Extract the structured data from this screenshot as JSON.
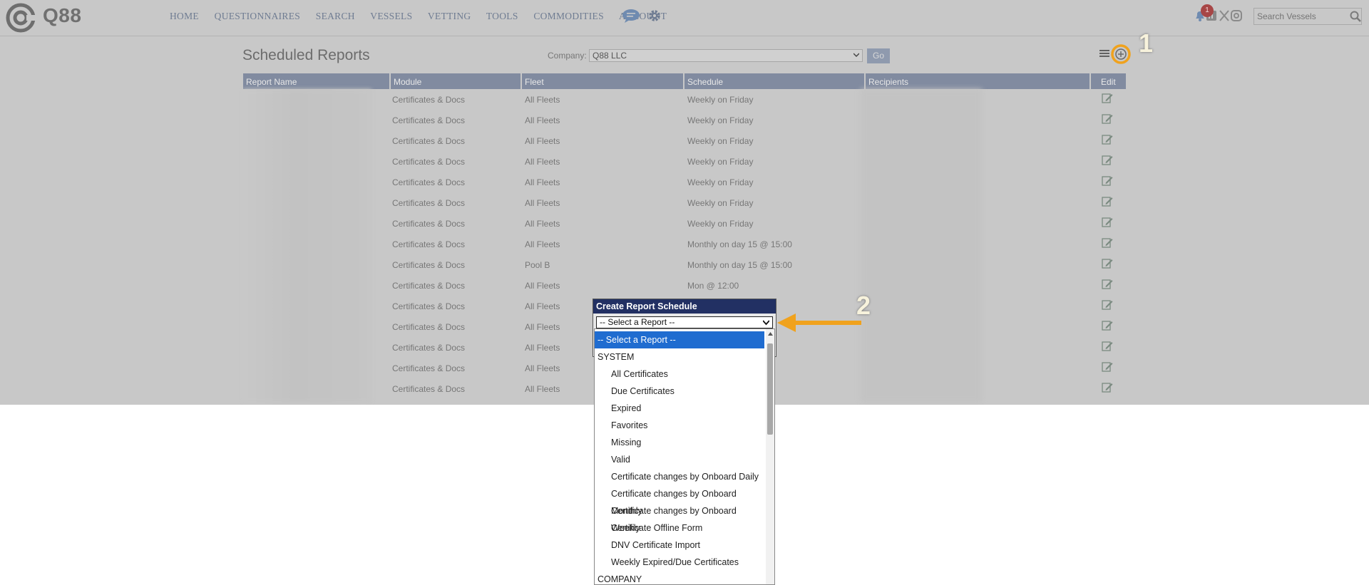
{
  "brand": {
    "name": "Q88"
  },
  "nav": {
    "items": [
      "HOME",
      "QUESTIONNAIRES",
      "SEARCH",
      "VESSELS",
      "VETTING",
      "TOOLS",
      "COMMODITIES",
      "ACCOUNT"
    ]
  },
  "notifications": {
    "count": "1"
  },
  "search": {
    "placeholder": "Search Vessels"
  },
  "page": {
    "title": "Scheduled Reports"
  },
  "company": {
    "label": "Company:",
    "selected": "Q88 LLC",
    "go_label": "Go"
  },
  "annotations": {
    "step1": "1",
    "step2": "2"
  },
  "table": {
    "headers": [
      "Report Name",
      "Module",
      "Fleet",
      "Schedule",
      "Recipients",
      "Edit"
    ],
    "rows": [
      {
        "module": "Certificates & Docs",
        "fleet": "All Fleets",
        "schedule": "Weekly on Friday"
      },
      {
        "module": "Certificates & Docs",
        "fleet": "All Fleets",
        "schedule": "Weekly on Friday"
      },
      {
        "module": "Certificates & Docs",
        "fleet": "All Fleets",
        "schedule": "Weekly on Friday"
      },
      {
        "module": "Certificates & Docs",
        "fleet": "All Fleets",
        "schedule": "Weekly on Friday"
      },
      {
        "module": "Certificates & Docs",
        "fleet": "All Fleets",
        "schedule": "Weekly on Friday"
      },
      {
        "module": "Certificates & Docs",
        "fleet": "All Fleets",
        "schedule": "Weekly on Friday"
      },
      {
        "module": "Certificates & Docs",
        "fleet": "All Fleets",
        "schedule": "Weekly on Friday"
      },
      {
        "module": "Certificates & Docs",
        "fleet": "All Fleets",
        "schedule": "Monthly on day 15 @ 15:00"
      },
      {
        "module": "Certificates & Docs",
        "fleet": "Pool B",
        "schedule": "Monthly on day 15 @ 15:00"
      },
      {
        "module": "Certificates & Docs",
        "fleet": "All Fleets",
        "schedule": "Mon @ 12:00"
      },
      {
        "module": "Certificates & Docs",
        "fleet": "All Fleets",
        "schedule": ""
      },
      {
        "module": "Certificates & Docs",
        "fleet": "All Fleets",
        "schedule": ""
      },
      {
        "module": "Certificates & Docs",
        "fleet": "All Fleets",
        "schedule": ""
      },
      {
        "module": "Certificates & Docs",
        "fleet": "All Fleets",
        "schedule": ""
      },
      {
        "module": "Certificates & Docs",
        "fleet": "All Fleets",
        "schedule": ""
      }
    ]
  },
  "dialog": {
    "title": "Create Report Schedule",
    "select_value": "-- Select a Report --",
    "options": [
      {
        "label": "-- Select a Report --",
        "kind": "selected"
      },
      {
        "label": "SYSTEM",
        "kind": "group"
      },
      {
        "label": "All Certificates",
        "kind": "item"
      },
      {
        "label": "Due Certificates",
        "kind": "item"
      },
      {
        "label": "Expired",
        "kind": "item"
      },
      {
        "label": "Favorites",
        "kind": "item"
      },
      {
        "label": "Missing",
        "kind": "item"
      },
      {
        "label": "Valid",
        "kind": "item"
      },
      {
        "label": "Certificate changes by Onboard Daily",
        "kind": "item"
      },
      {
        "label": "Certificate changes by Onboard Monthly",
        "kind": "item"
      },
      {
        "label": "Certificate changes by Onboard Weekly",
        "kind": "item"
      },
      {
        "label": "Certificate Offline Form",
        "kind": "item"
      },
      {
        "label": "DNV Certificate Import",
        "kind": "item"
      },
      {
        "label": "Weekly Expired/Due Certificates",
        "kind": "item"
      },
      {
        "label": "COMPANY",
        "kind": "group"
      }
    ]
  },
  "colors": {
    "header_bg": "#818ba0",
    "dialog_title_bg": "#223063",
    "selected_option": "#1f6cd0",
    "annotation_orange": "#f0a21d"
  }
}
